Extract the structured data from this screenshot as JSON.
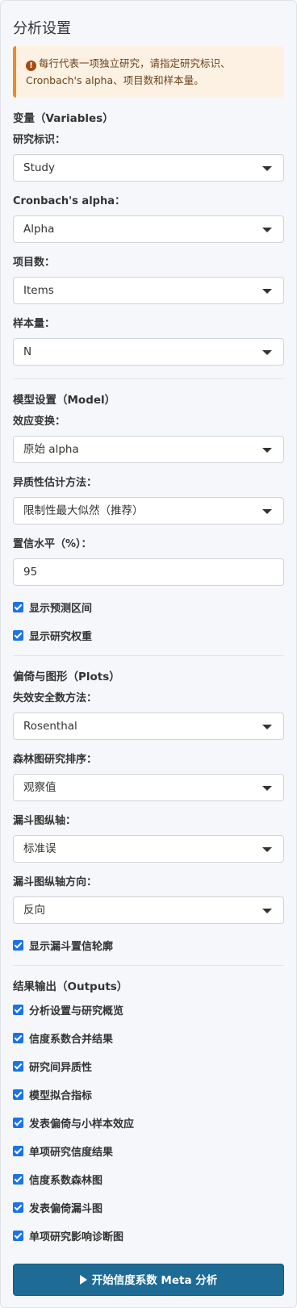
{
  "panel": {
    "title": "分析设置",
    "alert_icon": "info-circle-icon",
    "alert_text": "每行代表一项独立研究，请指定研究标识、Cronbach's alpha、项目数和样本量。"
  },
  "variables": {
    "section_title": "变量（Variables）",
    "study_label": "研究标识：",
    "study_value": "Study",
    "alpha_label": "Cronbach's alpha：",
    "alpha_value": "Alpha",
    "items_label": "项目数：",
    "items_value": "Items",
    "n_label": "样本量：",
    "n_value": "N"
  },
  "model": {
    "section_title": "模型设置（Model）",
    "transform_label": "效应变换：",
    "transform_value": "原始 alpha",
    "het_label": "异质性估计方法：",
    "het_value": "限制性最大似然（推荐）",
    "ci_label": "置信水平（%）：",
    "ci_value": "95",
    "checks": [
      "显示预测区间",
      "显示研究权重"
    ]
  },
  "plots": {
    "section_title": "偏倚与图形（Plots）",
    "failsafe_label": "失效安全数方法：",
    "failsafe_value": "Rosenthal",
    "forest_order_label": "森林图研究排序：",
    "forest_order_value": "观察值",
    "funnel_y_label": "漏斗图纵轴：",
    "funnel_y_value": "标准误",
    "funnel_dir_label": "漏斗图纵轴方向：",
    "funnel_dir_value": "反向",
    "contour_check": "显示漏斗置信轮廓"
  },
  "outputs": {
    "section_title": "结果输出（Outputs）",
    "checks": [
      "分析设置与研究概览",
      "信度系数合并结果",
      "研究间异质性",
      "模型拟合指标",
      "发表偏倚与小样本效应",
      "单项研究信度结果",
      "信度系数森林图",
      "发表偏倚漏斗图",
      "单项研究影响诊断图"
    ]
  },
  "run_button": {
    "icon": "play-icon",
    "label": "开始信度系数 Meta 分析"
  },
  "colors": {
    "accent": "#1a73e8",
    "button": "#1e6b96",
    "alert_border": "#f08a24",
    "alert_bg": "#fdf1e3"
  }
}
